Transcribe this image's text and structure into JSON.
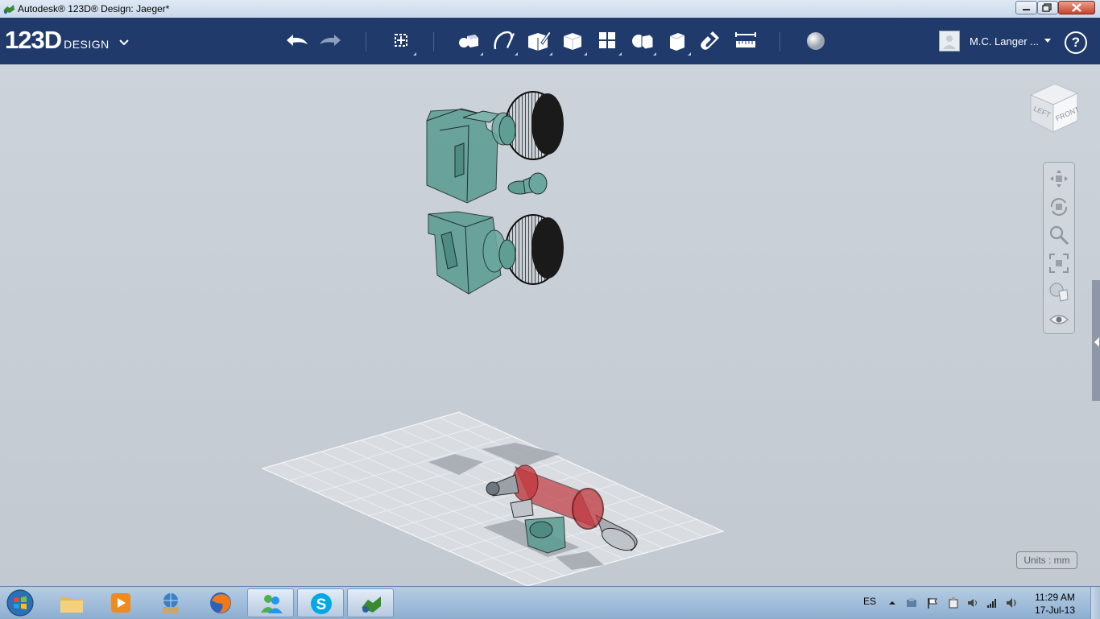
{
  "window": {
    "title": "Autodesk® 123D® Design: Jaeger*",
    "controls": [
      "minimize-icon",
      "maximize-icon",
      "close-icon"
    ]
  },
  "toolbar": {
    "logo_number": "123D",
    "logo_word": "DESIGN",
    "tools": [
      "undo-icon",
      "redo-icon",
      "transform-icon",
      "primitives-icon",
      "sketch-icon",
      "construct-icon",
      "modify-icon",
      "pattern-icon",
      "grouping-icon",
      "combine-icon",
      "snap-icon",
      "measure-icon",
      "material-icon"
    ],
    "user_name": "M.C. Langer ...",
    "help_label": "?"
  },
  "viewport": {
    "viewcube_faces": {
      "left": "LEFT",
      "front": "FRONT"
    },
    "nav_tools": [
      "pan-icon",
      "orbit-icon",
      "zoom-icon",
      "fit-icon",
      "visual-style-icon",
      "view-toggle-icon"
    ],
    "units_label": "Units : mm",
    "colors": {
      "teal_parts": "#5f9e95",
      "red_part": "#c0393f",
      "grid": "#ffffff",
      "background": "#c8ced5"
    }
  },
  "taskbar": {
    "apps": [
      "file-explorer-icon",
      "media-player-icon",
      "network-icon",
      "firefox-icon",
      "messenger-icon",
      "skype-icon",
      "123d-design-icon"
    ],
    "language": "ES",
    "time": "11:29 AM",
    "date": "17-Jul-13"
  }
}
